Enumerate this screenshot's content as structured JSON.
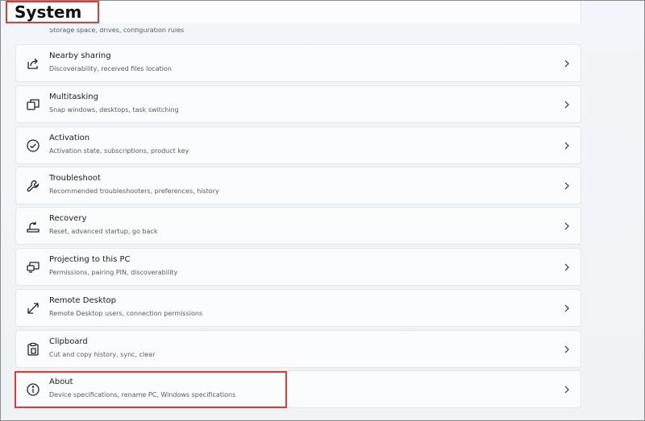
{
  "header": {
    "title": "System"
  },
  "items": [
    {
      "title": "",
      "subtitle": "Storage space, drives, configuration rules",
      "icon": "storage-icon"
    },
    {
      "title": "Nearby sharing",
      "subtitle": "Discoverability, received files location",
      "icon": "share-icon"
    },
    {
      "title": "Multitasking",
      "subtitle": "Snap windows, desktops, task switching",
      "icon": "multitasking-icon"
    },
    {
      "title": "Activation",
      "subtitle": "Activation state, subscriptions, product key",
      "icon": "check-circle-icon"
    },
    {
      "title": "Troubleshoot",
      "subtitle": "Recommended troubleshooters, preferences, history",
      "icon": "wrench-icon"
    },
    {
      "title": "Recovery",
      "subtitle": "Reset, advanced startup, go back",
      "icon": "recovery-icon"
    },
    {
      "title": "Projecting to this PC",
      "subtitle": "Permissions, pairing PIN, discoverability",
      "icon": "projector-icon"
    },
    {
      "title": "Remote Desktop",
      "subtitle": "Remote Desktop users, connection permissions",
      "icon": "remote-desktop-icon"
    },
    {
      "title": "Clipboard",
      "subtitle": "Cut and copy history, sync, clear",
      "icon": "clipboard-icon"
    },
    {
      "title": "About",
      "subtitle": "Device specifications, rename PC, Windows specifications",
      "icon": "info-icon"
    }
  ],
  "colors": {
    "highlight": "#e53935",
    "card_bg": "#fbfcfd",
    "page_bg": "#f2f5f9"
  }
}
